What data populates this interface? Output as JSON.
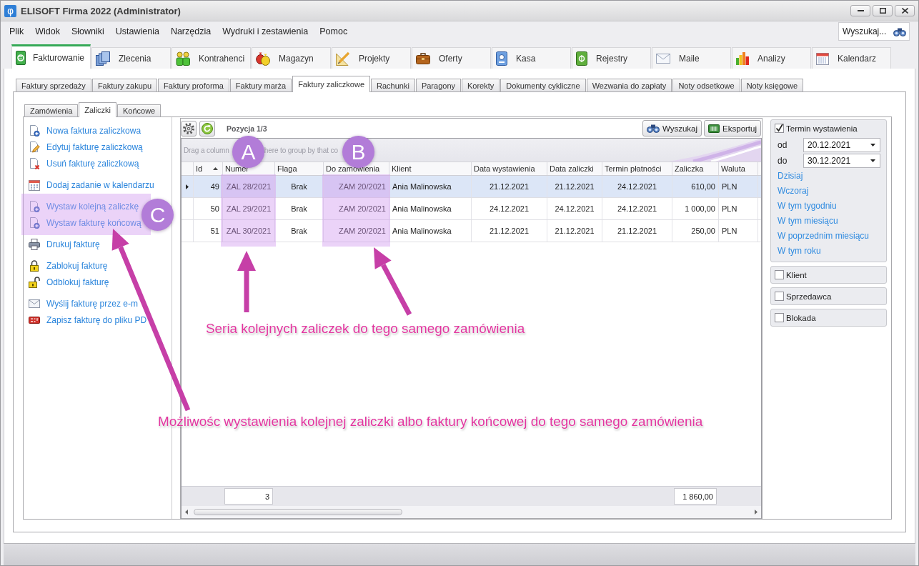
{
  "window": {
    "logo": "φ",
    "title": "ELISOFT Firma 2022 (Administrator)"
  },
  "menu": [
    "Plik",
    "Widok",
    "Słowniki",
    "Ustawienia",
    "Narzędzia",
    "Wydruki i zestawienia",
    "Pomoc"
  ],
  "search": {
    "placeholder": "Wyszukaj..."
  },
  "modules": [
    {
      "label": "Fakturowanie",
      "selected": true
    },
    {
      "label": "Zlecenia",
      "selected": false
    },
    {
      "label": "Kontrahenci",
      "selected": false
    },
    {
      "label": "Magazyn",
      "selected": false
    },
    {
      "label": "Projekty",
      "selected": false
    },
    {
      "label": "Oferty",
      "selected": false
    },
    {
      "label": "Kasa",
      "selected": false
    },
    {
      "label": "Rejestry",
      "selected": false
    },
    {
      "label": "Maile",
      "selected": false
    },
    {
      "label": "Analizy",
      "selected": false
    },
    {
      "label": "Kalendarz",
      "selected": false
    }
  ],
  "document_tabs": [
    {
      "label": "Faktury sprzedaży",
      "selected": false
    },
    {
      "label": "Faktury zakupu",
      "selected": false
    },
    {
      "label": "Faktury proforma",
      "selected": false
    },
    {
      "label": "Faktury marża",
      "selected": false
    },
    {
      "label": "Faktury zaliczkowe",
      "selected": true
    },
    {
      "label": "Rachunki",
      "selected": false
    },
    {
      "label": "Paragony",
      "selected": false
    },
    {
      "label": "Korekty",
      "selected": false
    },
    {
      "label": "Dokumenty cykliczne",
      "selected": false
    },
    {
      "label": "Wezwania do zapłaty",
      "selected": false
    },
    {
      "label": "Noty odsetkowe",
      "selected": false
    },
    {
      "label": "Noty księgowe",
      "selected": false
    }
  ],
  "view_tabs": [
    {
      "label": "Zamówienia",
      "selected": false
    },
    {
      "label": "Zaliczki",
      "selected": true
    },
    {
      "label": "Końcowe",
      "selected": false
    }
  ],
  "action_groups": [
    [
      {
        "label": "Nowa faktura zaliczkowa",
        "kind": "new"
      },
      {
        "label": "Edytuj fakturę zaliczkową",
        "kind": "edit"
      },
      {
        "label": "Usuń fakturę zaliczkową",
        "kind": "delete"
      }
    ],
    [
      {
        "label": "Dodaj zadanie w kalendarzu",
        "kind": "calendar"
      }
    ],
    [
      {
        "label": "Wystaw kolejną zaliczkę",
        "kind": "new"
      },
      {
        "label": "Wystaw fakturę końcową",
        "kind": "new"
      }
    ],
    [
      {
        "label": "Drukuj fakturę",
        "kind": "print"
      }
    ],
    [
      {
        "label": "Zablokuj fakturę",
        "kind": "lock"
      },
      {
        "label": "Odblokuj fakturę",
        "kind": "unlock"
      }
    ],
    [
      {
        "label": "Wyślij fakturę przez e-m",
        "kind": "email"
      },
      {
        "label": "Zapisz fakturę do pliku PD",
        "kind": "pdf"
      }
    ]
  ],
  "grid": {
    "position": "Pozycja 1/3",
    "buttons": [
      {
        "label": "Wyszukaj",
        "kind": "search"
      },
      {
        "label": "Eksportuj",
        "kind": "export"
      }
    ],
    "group_hint": [
      "Drag a column",
      "here to group by that co"
    ],
    "columns": [
      {
        "label": "Id",
        "sorted": true
      },
      {
        "label": "Numer",
        "sorted": false,
        "summary": "3"
      },
      {
        "label": "Flaga",
        "sorted": false
      },
      {
        "label": "Do zamówienia",
        "sorted": false
      },
      {
        "label": "Klient",
        "sorted": false
      },
      {
        "label": "Data wystawienia",
        "sorted": false
      },
      {
        "label": "Data zaliczki",
        "sorted": false
      },
      {
        "label": "Termin płatności",
        "sorted": false
      },
      {
        "label": "Zaliczka",
        "sorted": false,
        "summary": "1 860,00"
      },
      {
        "label": "Waluta",
        "sorted": false
      }
    ],
    "rows": [
      {
        "selected": true,
        "cells": [
          "49",
          "ZAL 28/2021",
          "Brak",
          "ZAM 20/2021",
          "Ania Malinowska",
          "21.12.2021",
          "21.12.2021",
          "24.12.2021",
          "610,00",
          "PLN"
        ]
      },
      {
        "selected": false,
        "cells": [
          "50",
          "ZAL 29/2021",
          "Brak",
          "ZAM 20/2021",
          "Ania Malinowska",
          "24.12.2021",
          "24.12.2021",
          "24.12.2021",
          "1 000,00",
          "PLN"
        ]
      },
      {
        "selected": false,
        "cells": [
          "51",
          "ZAL 30/2021",
          "Brak",
          "ZAM 20/2021",
          "Ania Malinowska",
          "21.12.2021",
          "21.12.2021",
          "21.12.2021",
          "250,00",
          "PLN"
        ]
      }
    ]
  },
  "filters": [
    {
      "label": "Termin wystawienia",
      "checked": true,
      "fields": [
        {
          "label": "od",
          "value": "20.12.2021"
        },
        {
          "label": "do",
          "value": "30.12.2021"
        }
      ],
      "links": [
        "Dzisiaj",
        "Wczoraj",
        "W tym tygodniu",
        "W tym miesiącu",
        "W poprzednim miesiącu",
        "W tym roku"
      ]
    },
    {
      "label": "Klient",
      "checked": false
    },
    {
      "label": "Sprzedawca",
      "checked": false
    },
    {
      "label": "Blokada",
      "checked": false
    }
  ],
  "annotations": {
    "badges": [
      "A",
      "B",
      "C"
    ],
    "captions": [
      "Seria kolejnych zaliczek do tego samego zamówienia",
      "Możliwośc wystawienia kolejnej zaliczki albo faktury końcowej do tego samego zamówienia"
    ]
  }
}
